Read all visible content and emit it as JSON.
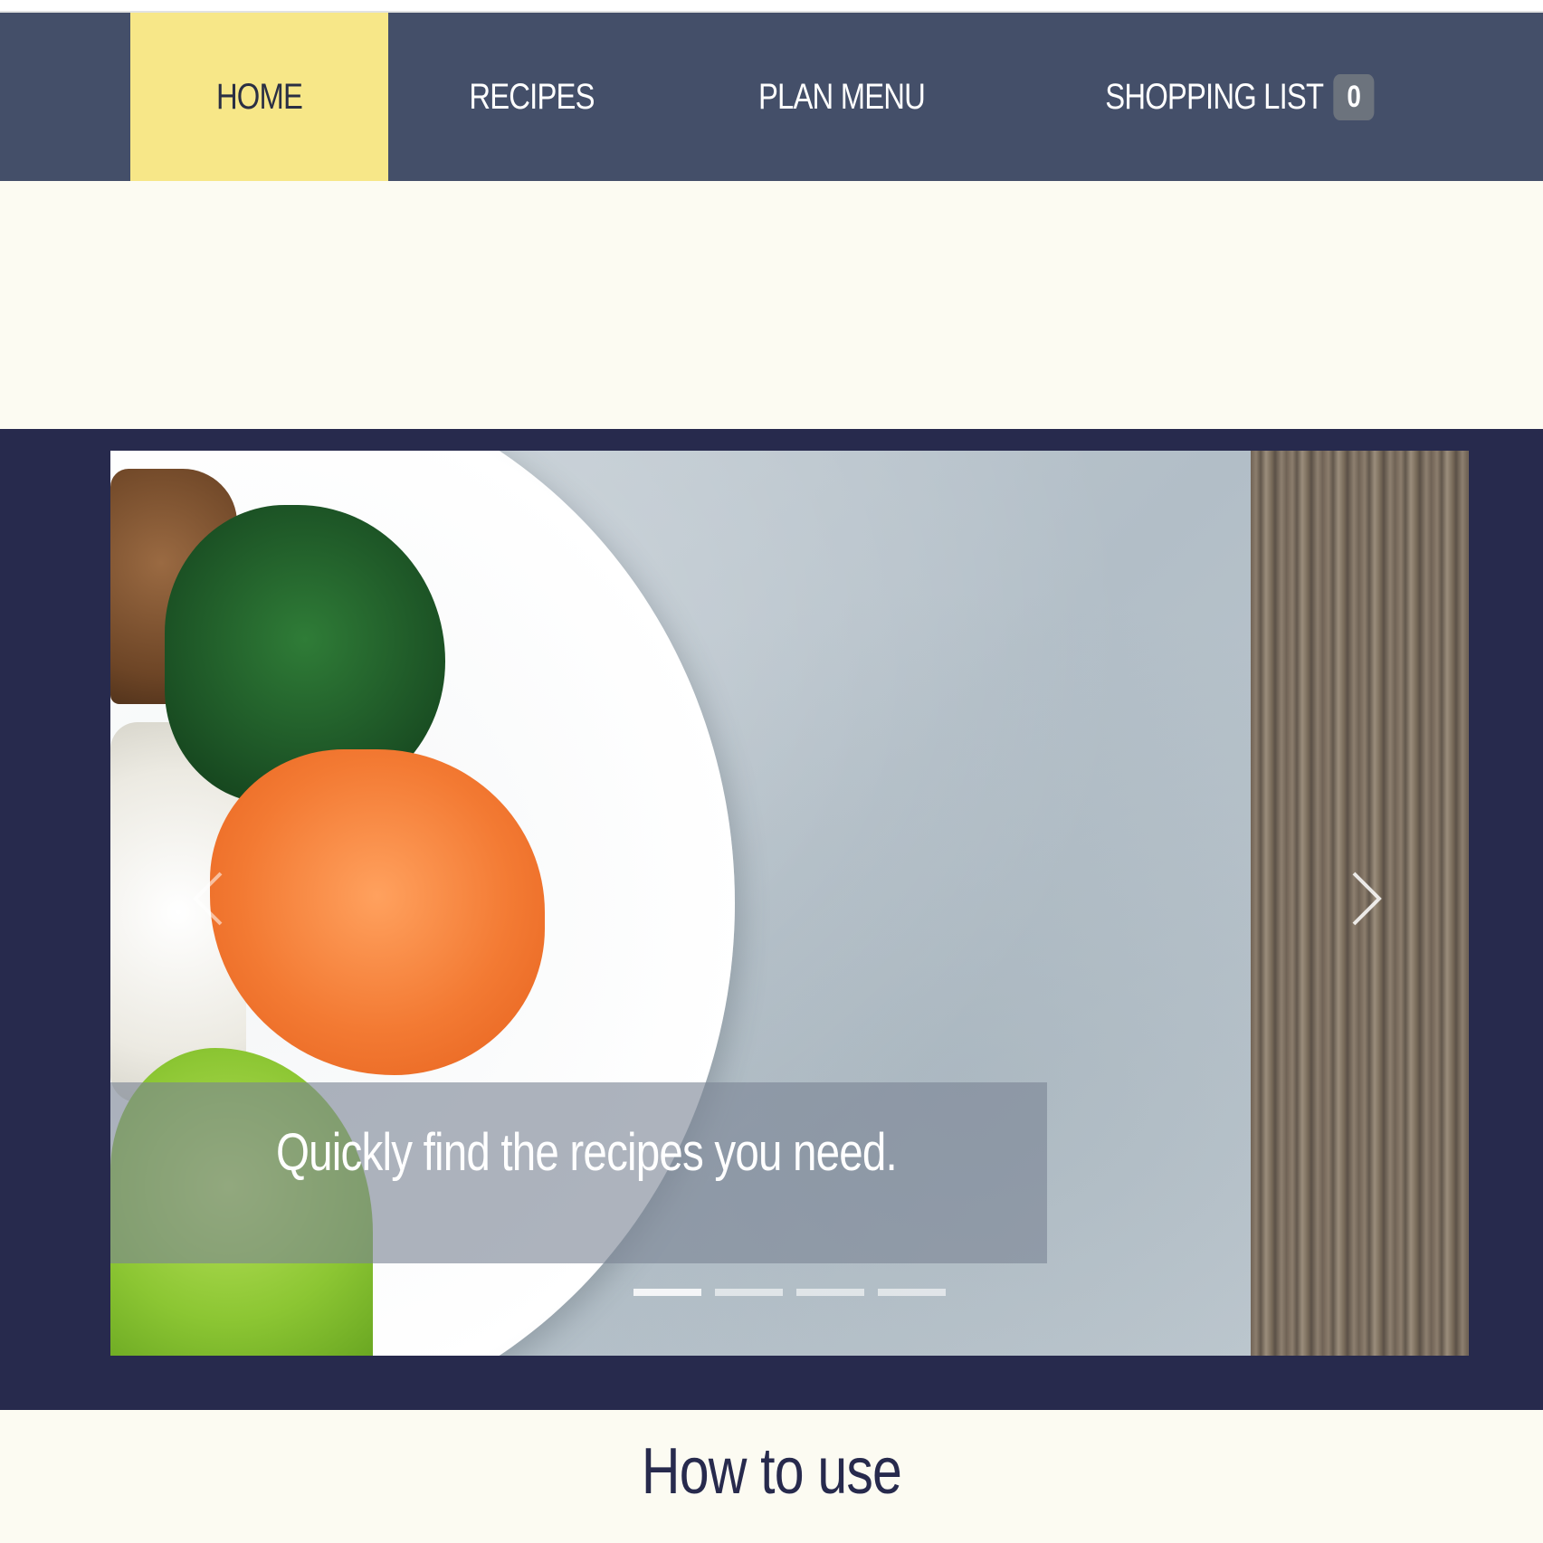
{
  "nav": {
    "items": [
      {
        "label": "HOME",
        "active": true
      },
      {
        "label": "RECIPES"
      },
      {
        "label": "PLAN MENU"
      },
      {
        "label": "SHOPPING LIST"
      }
    ],
    "shopping_count": "0",
    "colors": {
      "bar": "#444f69",
      "active": "#f7e788",
      "badge": "#6c737d"
    }
  },
  "hero": {
    "caption": "Quickly find the recipes you need.",
    "slide_count": 4,
    "active_slide": 1,
    "prev_icon": "chevron-left-icon",
    "next_icon": "chevron-right-icon",
    "background_color": "#272a4d"
  },
  "section": {
    "title": "How to use"
  }
}
